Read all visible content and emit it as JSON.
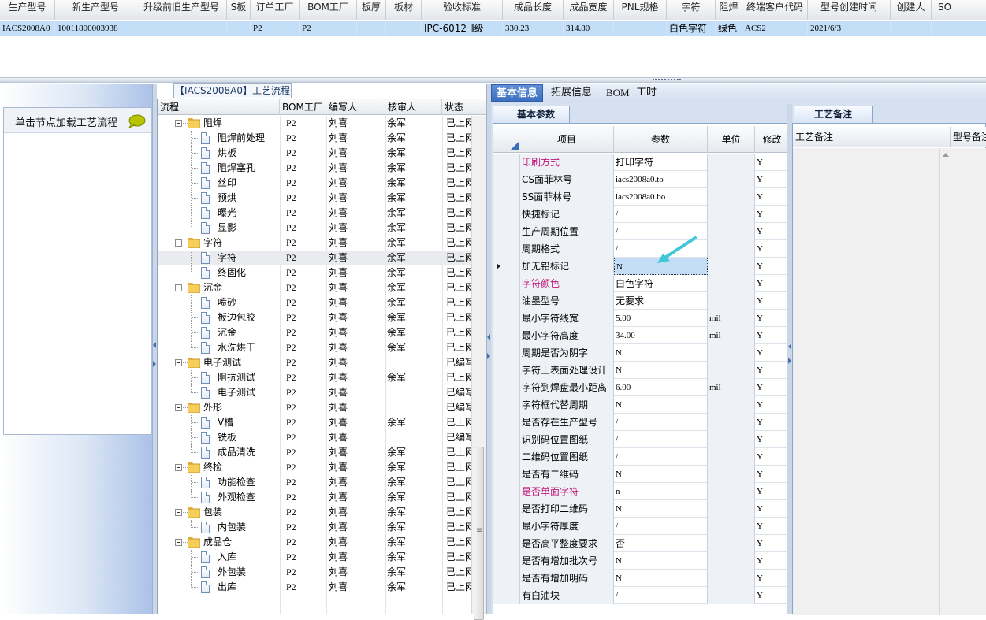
{
  "top_grid": {
    "columns": [
      "生产型号",
      "新生产型号",
      "升级前旧生产型号",
      "S板",
      "订单工厂",
      "BOM工厂",
      "板厚",
      "板材",
      "验收标准",
      "成品长度",
      "成品宽度",
      "PNL规格",
      "字符",
      "阻焊",
      "终端客户代码",
      "型号创建时间",
      "创建人",
      "SO"
    ],
    "row": [
      "IACS2008A0",
      "10011800003938",
      "",
      "",
      "P2",
      "P2",
      "",
      "",
      "IPC-6012 Ⅱ级",
      "330.23",
      "314.80",
      "",
      "白色字符",
      "绿色",
      "ACS2",
      "2021/6/3",
      "",
      ""
    ]
  },
  "left_panel": {
    "load_text": "单击节点加载工艺流程",
    "icon": "speech-bubble-icon"
  },
  "tree": {
    "caption": "【IACS2008A0】工艺流程",
    "columns": [
      "流程",
      "BOM工厂",
      "编写人",
      "核审人",
      "状态"
    ],
    "rows": [
      {
        "level": 0,
        "name": "阻焊",
        "bom": "P2",
        "writer": "刘喜",
        "reviewer": "余军",
        "status": "已上网"
      },
      {
        "level": 1,
        "name": "阻焊前处理",
        "bom": "P2",
        "writer": "刘喜",
        "reviewer": "余军",
        "status": "已上网"
      },
      {
        "level": 1,
        "name": "烘板",
        "bom": "P2",
        "writer": "刘喜",
        "reviewer": "余军",
        "status": "已上网"
      },
      {
        "level": 1,
        "name": "阻焊塞孔",
        "bom": "P2",
        "writer": "刘喜",
        "reviewer": "余军",
        "status": "已上网"
      },
      {
        "level": 1,
        "name": "丝印",
        "bom": "P2",
        "writer": "刘喜",
        "reviewer": "余军",
        "status": "已上网"
      },
      {
        "level": 1,
        "name": "预烘",
        "bom": "P2",
        "writer": "刘喜",
        "reviewer": "余军",
        "status": "已上网"
      },
      {
        "level": 1,
        "name": "曝光",
        "bom": "P2",
        "writer": "刘喜",
        "reviewer": "余军",
        "status": "已上网"
      },
      {
        "level": 1,
        "name": "显影",
        "bom": "P2",
        "writer": "刘喜",
        "reviewer": "余军",
        "status": "已上网"
      },
      {
        "level": 0,
        "name": "字符",
        "bom": "P2",
        "writer": "刘喜",
        "reviewer": "余军",
        "status": "已上网"
      },
      {
        "level": 1,
        "name": "字符",
        "bom": "P2",
        "writer": "刘喜",
        "reviewer": "余军",
        "status": "已上网",
        "selected": true
      },
      {
        "level": 1,
        "name": "终固化",
        "bom": "P2",
        "writer": "刘喜",
        "reviewer": "余军",
        "status": "已上网"
      },
      {
        "level": 0,
        "name": "沉金",
        "bom": "P2",
        "writer": "刘喜",
        "reviewer": "余军",
        "status": "已上网"
      },
      {
        "level": 1,
        "name": "喷砂",
        "bom": "P2",
        "writer": "刘喜",
        "reviewer": "余军",
        "status": "已上网"
      },
      {
        "level": 1,
        "name": "板边包胶",
        "bom": "P2",
        "writer": "刘喜",
        "reviewer": "余军",
        "status": "已上网"
      },
      {
        "level": 1,
        "name": "沉金",
        "bom": "P2",
        "writer": "刘喜",
        "reviewer": "余军",
        "status": "已上网"
      },
      {
        "level": 1,
        "name": "水洗烘干",
        "bom": "P2",
        "writer": "刘喜",
        "reviewer": "余军",
        "status": "已上网"
      },
      {
        "level": 0,
        "name": "电子测试",
        "bom": "P2",
        "writer": "刘喜",
        "reviewer": "",
        "status": "已编写"
      },
      {
        "level": 1,
        "name": "阻抗测试",
        "bom": "P2",
        "writer": "刘喜",
        "reviewer": "余军",
        "status": "已上网"
      },
      {
        "level": 1,
        "name": "电子测试",
        "bom": "P2",
        "writer": "刘喜",
        "reviewer": "",
        "status": "已编写"
      },
      {
        "level": 0,
        "name": "外形",
        "bom": "P2",
        "writer": "刘喜",
        "reviewer": "",
        "status": "已编写"
      },
      {
        "level": 1,
        "name": "V槽",
        "bom": "P2",
        "writer": "刘喜",
        "reviewer": "余军",
        "status": "已上网"
      },
      {
        "level": 1,
        "name": "铣板",
        "bom": "P2",
        "writer": "刘喜",
        "reviewer": "",
        "status": "已编写"
      },
      {
        "level": 1,
        "name": "成品清洗",
        "bom": "P2",
        "writer": "刘喜",
        "reviewer": "余军",
        "status": "已上网"
      },
      {
        "level": 0,
        "name": "终检",
        "bom": "P2",
        "writer": "刘喜",
        "reviewer": "余军",
        "status": "已上网"
      },
      {
        "level": 1,
        "name": "功能检查",
        "bom": "P2",
        "writer": "刘喜",
        "reviewer": "余军",
        "status": "已上网"
      },
      {
        "level": 1,
        "name": "外观检查",
        "bom": "P2",
        "writer": "刘喜",
        "reviewer": "余军",
        "status": "已上网"
      },
      {
        "level": 0,
        "name": "包装",
        "bom": "P2",
        "writer": "刘喜",
        "reviewer": "余军",
        "status": "已上网"
      },
      {
        "level": 1,
        "name": "内包装",
        "bom": "P2",
        "writer": "刘喜",
        "reviewer": "余军",
        "status": "已上网"
      },
      {
        "level": 0,
        "name": "成品仓",
        "bom": "P2",
        "writer": "刘喜",
        "reviewer": "余军",
        "status": "已上网"
      },
      {
        "level": 1,
        "name": "入库",
        "bom": "P2",
        "writer": "刘喜",
        "reviewer": "余军",
        "status": "已上网"
      },
      {
        "level": 1,
        "name": "外包装",
        "bom": "P2",
        "writer": "刘喜",
        "reviewer": "余军",
        "status": "已上网"
      },
      {
        "level": 1,
        "name": "出库",
        "bom": "P2",
        "writer": "刘喜",
        "reviewer": "余军",
        "status": "已上网"
      }
    ]
  },
  "tabs": [
    "基本信息",
    "拓展信息",
    "BOM",
    "工时"
  ],
  "active_tab": "基本信息",
  "params": {
    "sub_tab": "基本参数",
    "columns": [
      "项目",
      "参数",
      "单位",
      "修改"
    ],
    "rows": [
      {
        "item": "印刷方式",
        "value": "打印字符",
        "unit": "",
        "edit": "Y",
        "pink": true
      },
      {
        "item": "CS面菲林号",
        "value": "iacs2008a0.to",
        "unit": "",
        "edit": "Y"
      },
      {
        "item": "SS面菲林号",
        "value": "iacs2008a0.bo",
        "unit": "",
        "edit": "Y"
      },
      {
        "item": "快捷标记",
        "value": "/",
        "unit": "",
        "edit": "Y"
      },
      {
        "item": "生产周期位置",
        "value": "/",
        "unit": "",
        "edit": "Y"
      },
      {
        "item": "周期格式",
        "value": "/",
        "unit": "",
        "edit": "Y"
      },
      {
        "item": "加无铅标记",
        "value": "N",
        "unit": "",
        "edit": "Y",
        "current": true
      },
      {
        "item": "字符颜色",
        "value": "白色字符",
        "unit": "",
        "edit": "Y",
        "pink": true
      },
      {
        "item": "油墨型号",
        "value": "无要求",
        "unit": "",
        "edit": "Y"
      },
      {
        "item": "最小字符线宽",
        "value": "5.00",
        "unit": "mil",
        "edit": "Y"
      },
      {
        "item": "最小字符高度",
        "value": "34.00",
        "unit": "mil",
        "edit": "Y"
      },
      {
        "item": "周期是否为阴字",
        "value": "N",
        "unit": "",
        "edit": "Y"
      },
      {
        "item": "字符上表面处理设计",
        "value": "N",
        "unit": "",
        "edit": "Y"
      },
      {
        "item": "字符到焊盘最小距离",
        "value": "6.00",
        "unit": "mil",
        "edit": "Y"
      },
      {
        "item": "字符框代替周期",
        "value": "N",
        "unit": "",
        "edit": "Y"
      },
      {
        "item": "是否存在生产型号",
        "value": "/",
        "unit": "",
        "edit": "Y"
      },
      {
        "item": "识别码位置图纸",
        "value": "/",
        "unit": "",
        "edit": "Y"
      },
      {
        "item": "二维码位置图纸",
        "value": "/",
        "unit": "",
        "edit": "Y"
      },
      {
        "item": "是否有二维码",
        "value": "N",
        "unit": "",
        "edit": "Y"
      },
      {
        "item": "是否单面字符",
        "value": "n",
        "unit": "",
        "edit": "Y",
        "pink": true
      },
      {
        "item": "是否打印二维码",
        "value": "N",
        "unit": "",
        "edit": "Y"
      },
      {
        "item": "最小字符厚度",
        "value": "/",
        "unit": "",
        "edit": "Y"
      },
      {
        "item": "是否高平整度要求",
        "value": "否",
        "unit": "",
        "edit": "Y"
      },
      {
        "item": "是否有增加批次号",
        "value": "N",
        "unit": "",
        "edit": "Y"
      },
      {
        "item": "是否有增加明码",
        "value": "N",
        "unit": "",
        "edit": "Y"
      },
      {
        "item": "有白油块",
        "value": "/",
        "unit": "",
        "edit": "Y"
      }
    ]
  },
  "notes": {
    "tab": "工艺备注",
    "columns": [
      "工艺备注",
      "型号备注"
    ]
  },
  "colors": {
    "selected_row": "#c3def7",
    "active_tab": "#3c6fc0",
    "pink_label": "#c0177a",
    "annotation_arrow": "#3fc7d6"
  }
}
